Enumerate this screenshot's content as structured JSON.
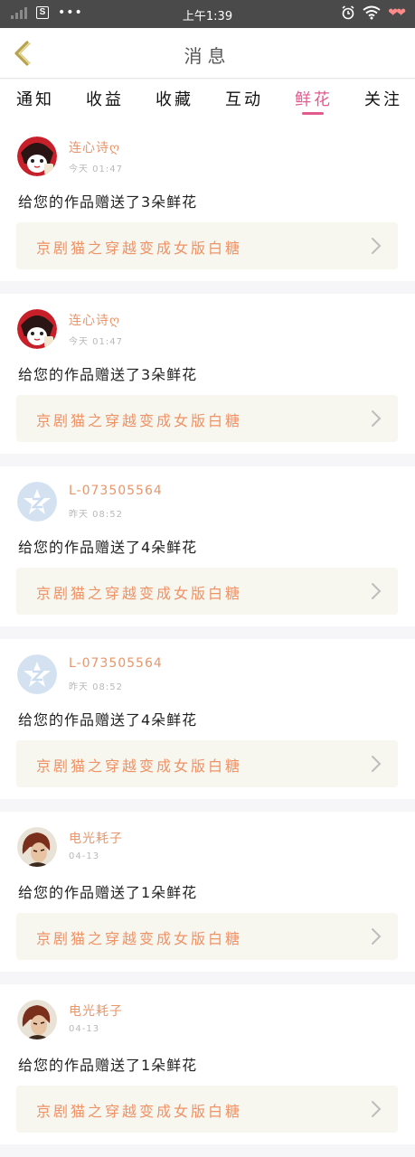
{
  "status_bar": {
    "time": "上午1:39",
    "app_icon": "S",
    "more": "•••",
    "icons": [
      "signal-icon",
      "app-s-icon",
      "alarm-icon",
      "wifi-icon",
      "hearts-icon"
    ]
  },
  "header": {
    "title": "消息",
    "back_icon": "chevron-left-icon"
  },
  "tabs": [
    {
      "label": "通知",
      "active": false
    },
    {
      "label": "收益",
      "active": false
    },
    {
      "label": "收藏",
      "active": false
    },
    {
      "label": "互动",
      "active": false
    },
    {
      "label": "鲜花",
      "active": true
    },
    {
      "label": "关注",
      "active": false
    }
  ],
  "colors": {
    "accent": "#e25a8e",
    "username": "#e8966a",
    "work_title": "#ef9265",
    "work_bg": "#f7f6ef",
    "statusbar": "#4a4a4a"
  },
  "messages": [
    {
      "user": "连心诗ღ",
      "time": "今天 01:47",
      "text": "给您的作品赠送了3朵鲜花",
      "work": "京剧猫之穿越变成女版白糖",
      "avatar": "avatar-red"
    },
    {
      "user": "连心诗ღ",
      "time": "今天 01:47",
      "text": "给您的作品赠送了3朵鲜花",
      "work": "京剧猫之穿越变成女版白糖",
      "avatar": "avatar-red"
    },
    {
      "user": "L-073505564",
      "time": "昨天 08:52",
      "text": "给您的作品赠送了4朵鲜花",
      "work": "京剧猫之穿越变成女版白糖",
      "avatar": "avatar-default"
    },
    {
      "user": "L-073505564",
      "time": "昨天 08:52",
      "text": "给您的作品赠送了4朵鲜花",
      "work": "京剧猫之穿越变成女版白糖",
      "avatar": "avatar-default"
    },
    {
      "user": "电光耗子",
      "time": "04-13",
      "text": "给您的作品赠送了1朵鲜花",
      "work": "京剧猫之穿越变成女版白糖",
      "avatar": "avatar-brown"
    },
    {
      "user": "电光耗子",
      "time": "04-13",
      "text": "给您的作品赠送了1朵鲜花",
      "work": "京剧猫之穿越变成女版白糖",
      "avatar": "avatar-brown"
    }
  ]
}
